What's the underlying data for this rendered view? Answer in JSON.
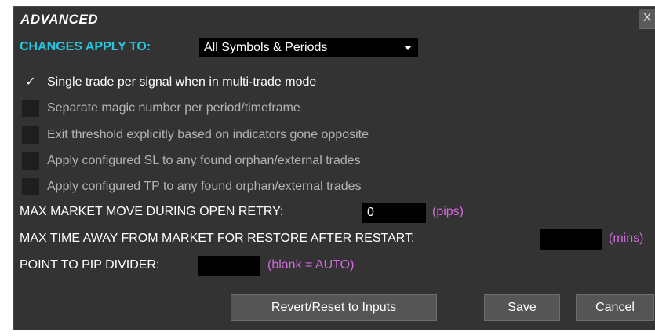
{
  "dialog": {
    "title": "ADVANCED",
    "close_label": "X"
  },
  "apply": {
    "label": "CHANGES APPLY TO:",
    "selected": "All Symbols & Periods"
  },
  "options": [
    {
      "label": "Single trade per signal when in multi-trade mode",
      "checked": true,
      "check_glyph": "✓"
    },
    {
      "label": "Separate magic number per period/timeframe",
      "checked": false
    },
    {
      "label": "Exit threshold explicitly based on indicators gone opposite",
      "checked": false
    },
    {
      "label": "Apply configured SL to any found orphan/external trades",
      "checked": false
    },
    {
      "label": "Apply configured TP to any found orphan/external trades",
      "checked": false
    }
  ],
  "fields": {
    "max_move": {
      "label": "MAX MARKET MOVE DURING OPEN RETRY:",
      "value": "0",
      "unit": "(pips)"
    },
    "max_time": {
      "label": "MAX TIME AWAY FROM MARKET FOR RESTORE AFTER RESTART:",
      "value": "",
      "unit": "(mins)"
    },
    "pip_divider": {
      "label": "POINT TO PIP DIVIDER:",
      "value": "",
      "unit": "(blank = AUTO)"
    }
  },
  "buttons": {
    "revert": "Revert/Reset to Inputs",
    "save": "Save",
    "cancel": "Cancel"
  },
  "colors": {
    "panel_bg": "#333333",
    "accent_cyan": "#27c7e0",
    "unit_magenta": "#d36be0"
  }
}
